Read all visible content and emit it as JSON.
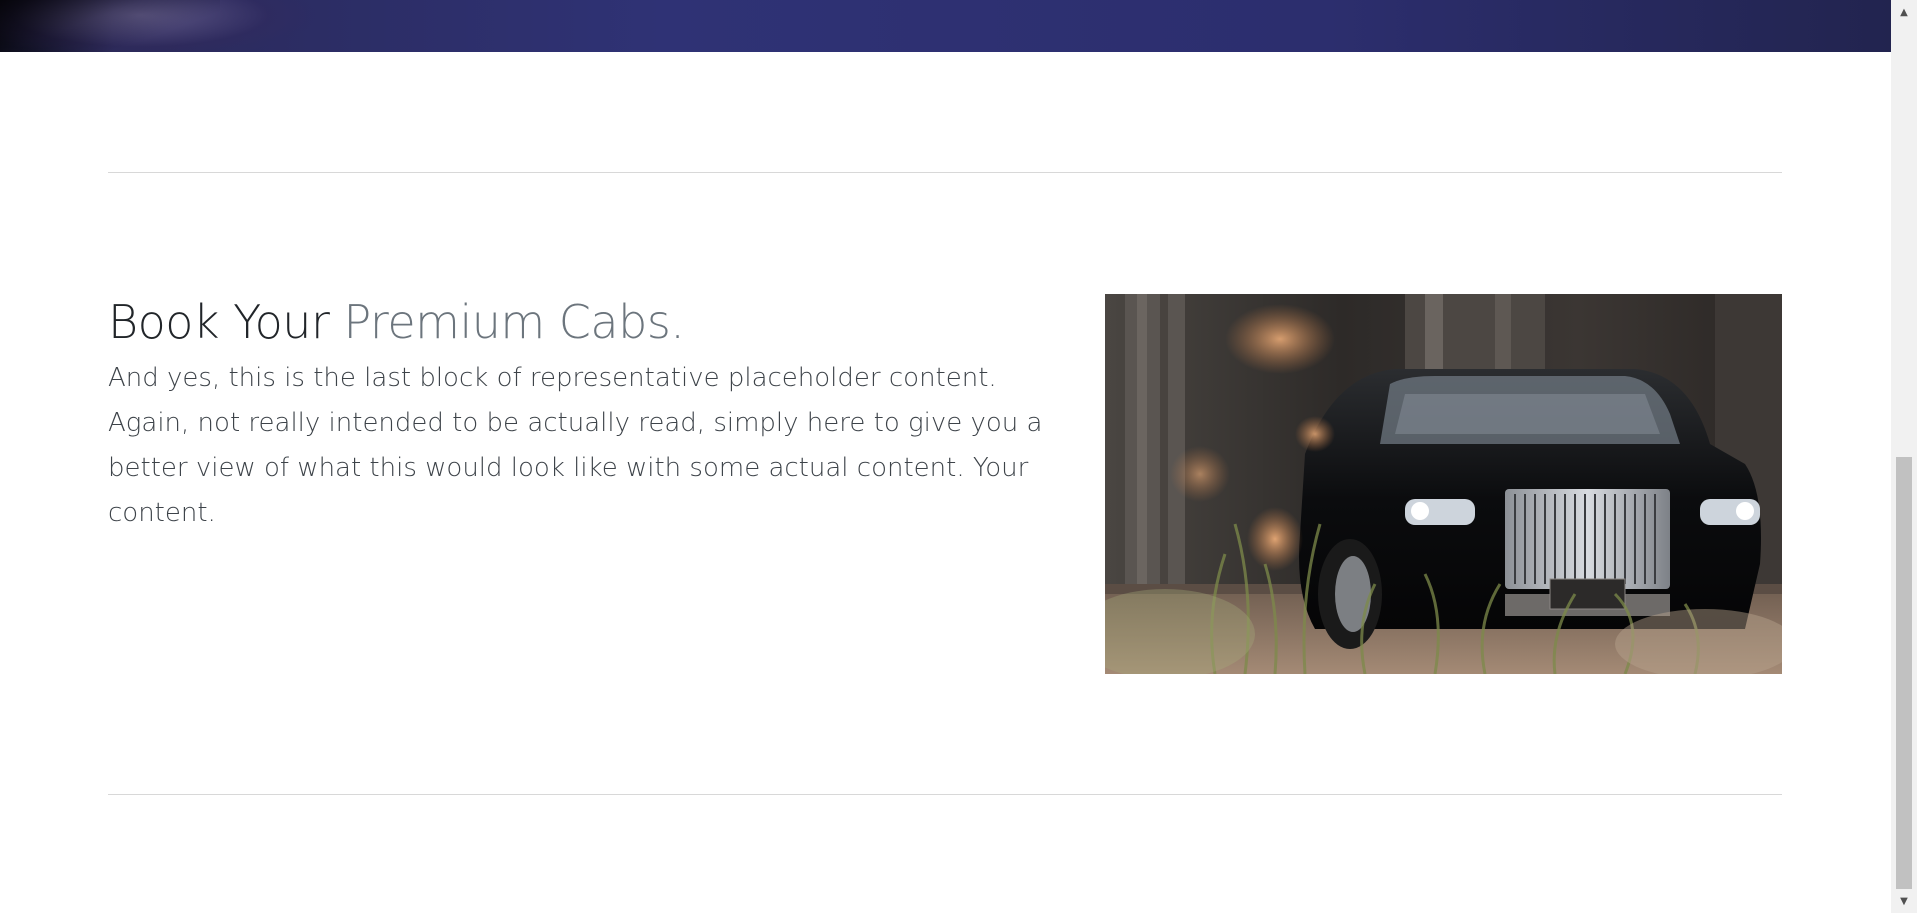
{
  "feature": {
    "heading_main": "Book Your",
    "heading_muted": "Premium Cabs.",
    "lead": "And yes, this is the last block of representative placeholder content. Again, not really intended to be actually read, simply here to give you a better view of what this would look like with some actual content. Your content."
  },
  "scrollbar": {
    "up_arrow": "▲",
    "down_arrow": "▼"
  },
  "colors": {
    "heading": "#212529",
    "heading_muted": "#6c757d",
    "hero_strip": "#2f3275",
    "divider": "#d8d8d8"
  }
}
